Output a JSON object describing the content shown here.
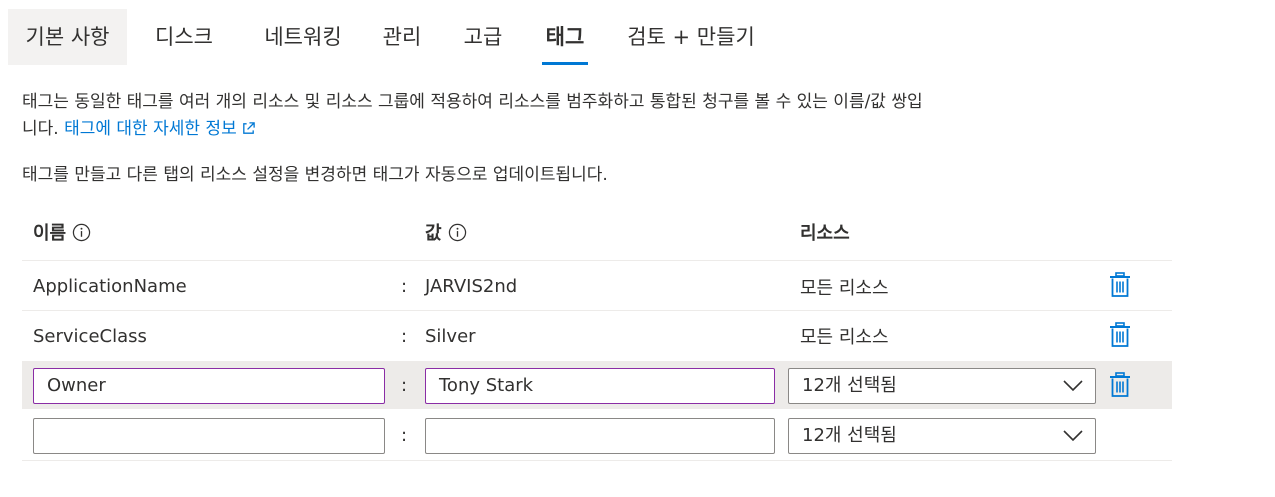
{
  "tabs": [
    {
      "label": "기본 사항"
    },
    {
      "label": "디스크"
    },
    {
      "label": "네트워킹"
    },
    {
      "label": "관리"
    },
    {
      "label": "고급"
    },
    {
      "label": "태그"
    },
    {
      "label": "검토 + 만들기"
    }
  ],
  "description": {
    "line1": "태그는 동일한 태그를 여러 개의 리소스 및 리소스 그룹에 적용하여 리소스를 범주화하고 통합된 청구를 볼 수 있는 이름/값 쌍입",
    "line2_prefix": "니다.",
    "link": "태그에 대한 자세한 정보",
    "note": "태그를 만들고 다른 탭의 리소스 설정을 변경하면 태그가 자동으로 업데이트됩니다."
  },
  "table": {
    "headers": {
      "name": "이름",
      "value": "값",
      "resource": "리소스"
    },
    "separator": ":",
    "rows": [
      {
        "name": "ApplicationName",
        "value": "JARVIS2nd",
        "resource": "모든 리소스"
      },
      {
        "name": "ServiceClass",
        "value": "Silver",
        "resource": "모든 리소스"
      }
    ],
    "edit_row": {
      "name": "Owner",
      "value": "Tony Stark",
      "resource": "12개 선택됨"
    },
    "new_row": {
      "name": "",
      "value": "",
      "resource": "12개 선택됨"
    }
  },
  "colors": {
    "accent": "#0078d4",
    "focus_border": "#8a2da5",
    "row_highlight": "#edebe9"
  },
  "icons": [
    "info-icon",
    "external-link-icon",
    "trash-icon",
    "chevron-down-icon"
  ]
}
